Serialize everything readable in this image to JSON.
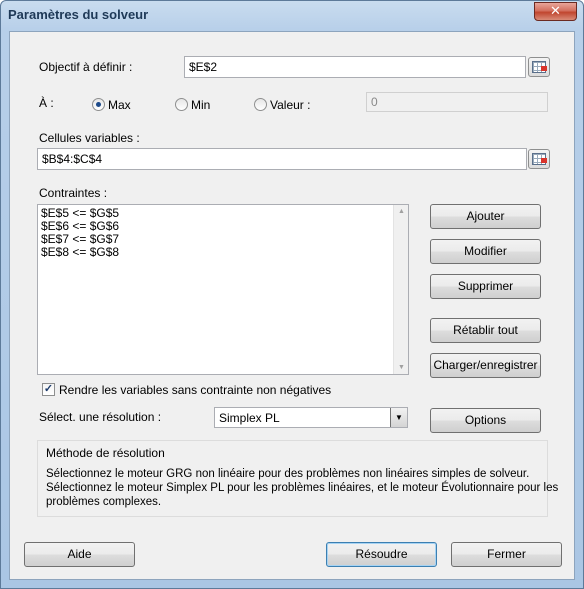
{
  "window": {
    "title": "Paramètres du solveur",
    "close_glyph": "✕"
  },
  "objective": {
    "label": "Objectif à définir :",
    "value": "$E$2"
  },
  "to": {
    "label": "À :",
    "max_label": "Max",
    "min_label": "Min",
    "value_label": "Valeur :",
    "value_input": "0",
    "selected": "max"
  },
  "variables": {
    "label": "Cellules variables :",
    "value": "$B$4:$C$4"
  },
  "constraints": {
    "label": "Contraintes :",
    "items": [
      "$E$5 <= $G$5",
      "$E$6 <= $G$6",
      "$E$7 <= $G$7",
      "$E$8 <= $G$8"
    ]
  },
  "buttons": {
    "add": "Ajouter",
    "change": "Modifier",
    "delete": "Supprimer",
    "reset_all": "Rétablir tout",
    "load_save": "Charger/enregistrer",
    "options": "Options",
    "help": "Aide",
    "solve": "Résoudre",
    "close": "Fermer"
  },
  "nonneg": {
    "label": "Rendre les variables sans contrainte non négatives",
    "checked": true
  },
  "method": {
    "label": "Sélect. une résolution :",
    "value": "Simplex PL"
  },
  "method_info": {
    "title": "Méthode de résolution",
    "line1": "Sélectionnez le moteur GRG non linéaire pour des problèmes non linéaires simples de solveur.",
    "line2": "Sélectionnez le moteur Simplex PL pour les problèmes linéaires, et le moteur Évolutionnaire pour les",
    "line3": "problèmes complexes."
  }
}
